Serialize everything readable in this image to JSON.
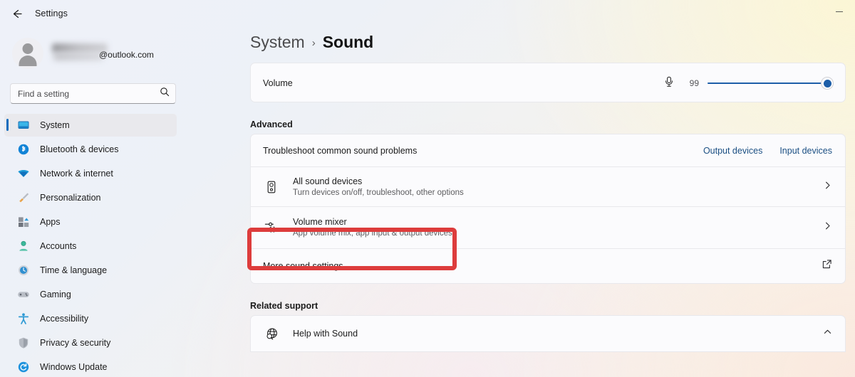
{
  "window": {
    "title": "Settings",
    "back_icon": "back-arrow-icon",
    "minimize_label": "Minimize"
  },
  "account": {
    "email_domain": "@outlook.com",
    "avatar_icon": "user-avatar-icon"
  },
  "search": {
    "placeholder": "Find a setting",
    "value": "",
    "icon": "search-icon"
  },
  "sidebar": {
    "items": [
      {
        "label": "System",
        "icon": "monitor-icon",
        "selected": true
      },
      {
        "label": "Bluetooth & devices",
        "icon": "bluetooth-icon",
        "selected": false
      },
      {
        "label": "Network & internet",
        "icon": "wifi-icon",
        "selected": false
      },
      {
        "label": "Personalization",
        "icon": "paintbrush-icon",
        "selected": false
      },
      {
        "label": "Apps",
        "icon": "apps-icon",
        "selected": false
      },
      {
        "label": "Accounts",
        "icon": "person-icon",
        "selected": false
      },
      {
        "label": "Time & language",
        "icon": "clock-icon",
        "selected": false
      },
      {
        "label": "Gaming",
        "icon": "gamepad-icon",
        "selected": false
      },
      {
        "label": "Accessibility",
        "icon": "accessibility-icon",
        "selected": false
      },
      {
        "label": "Privacy & security",
        "icon": "shield-icon",
        "selected": false
      },
      {
        "label": "Windows Update",
        "icon": "update-icon",
        "selected": false
      }
    ]
  },
  "breadcrumb": {
    "parent": "System",
    "separator": "›",
    "current": "Sound"
  },
  "volume": {
    "label": "Volume",
    "icon": "speaker-icon",
    "value": "99"
  },
  "advanced": {
    "section_label": "Advanced",
    "troubleshoot": {
      "title": "Troubleshoot common sound problems",
      "output_link": "Output devices",
      "input_link": "Input devices"
    },
    "all_sound_devices": {
      "title": "All sound devices",
      "subtitle": "Turn devices on/off, troubleshoot, other options",
      "icon": "speaker-device-icon",
      "chevron": "chevron-right-icon"
    },
    "volume_mixer": {
      "title": "Volume mixer",
      "subtitle": "App volume mix, app input & output devices",
      "icon": "volume-mixer-icon",
      "chevron": "chevron-right-icon",
      "highlighted": true,
      "highlight_color": "#dd3c3c"
    },
    "more_sound_settings": {
      "title": "More sound settings",
      "icon": "external-link-icon"
    }
  },
  "related_support": {
    "section_label": "Related support",
    "help": {
      "title": "Help with Sound",
      "icon": "globe-search-icon",
      "chevron": "chevron-up-icon"
    }
  },
  "colors": {
    "accent": "#0f6cbd",
    "slider": "#1d5ea8",
    "link": "#1b4f83",
    "highlight": "#dd3c3c"
  }
}
